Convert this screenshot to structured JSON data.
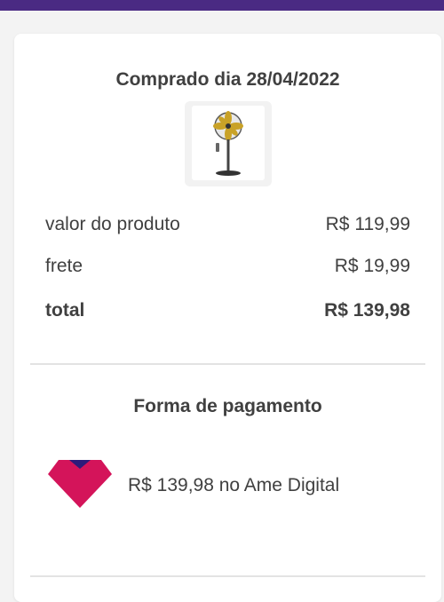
{
  "order": {
    "purchase_date_label": "Comprado dia 28/04/2022",
    "product_image_icon": "standing-fan-icon"
  },
  "summary": {
    "product_label": "valor do produto",
    "product_value": "R$ 119,99",
    "shipping_label": "frete",
    "shipping_value": "R$ 19,99",
    "total_label": "total",
    "total_value": "R$ 139,98"
  },
  "payment": {
    "title": "Forma de pagamento",
    "method_text": "R$ 139,98 no Ame Digital",
    "logo_icon": "ame-digital-logo-icon",
    "colors": {
      "logo_red": "#d4145a",
      "logo_navy": "#2d1b7a"
    }
  },
  "theme": {
    "topbar_color": "#4a2a83"
  }
}
